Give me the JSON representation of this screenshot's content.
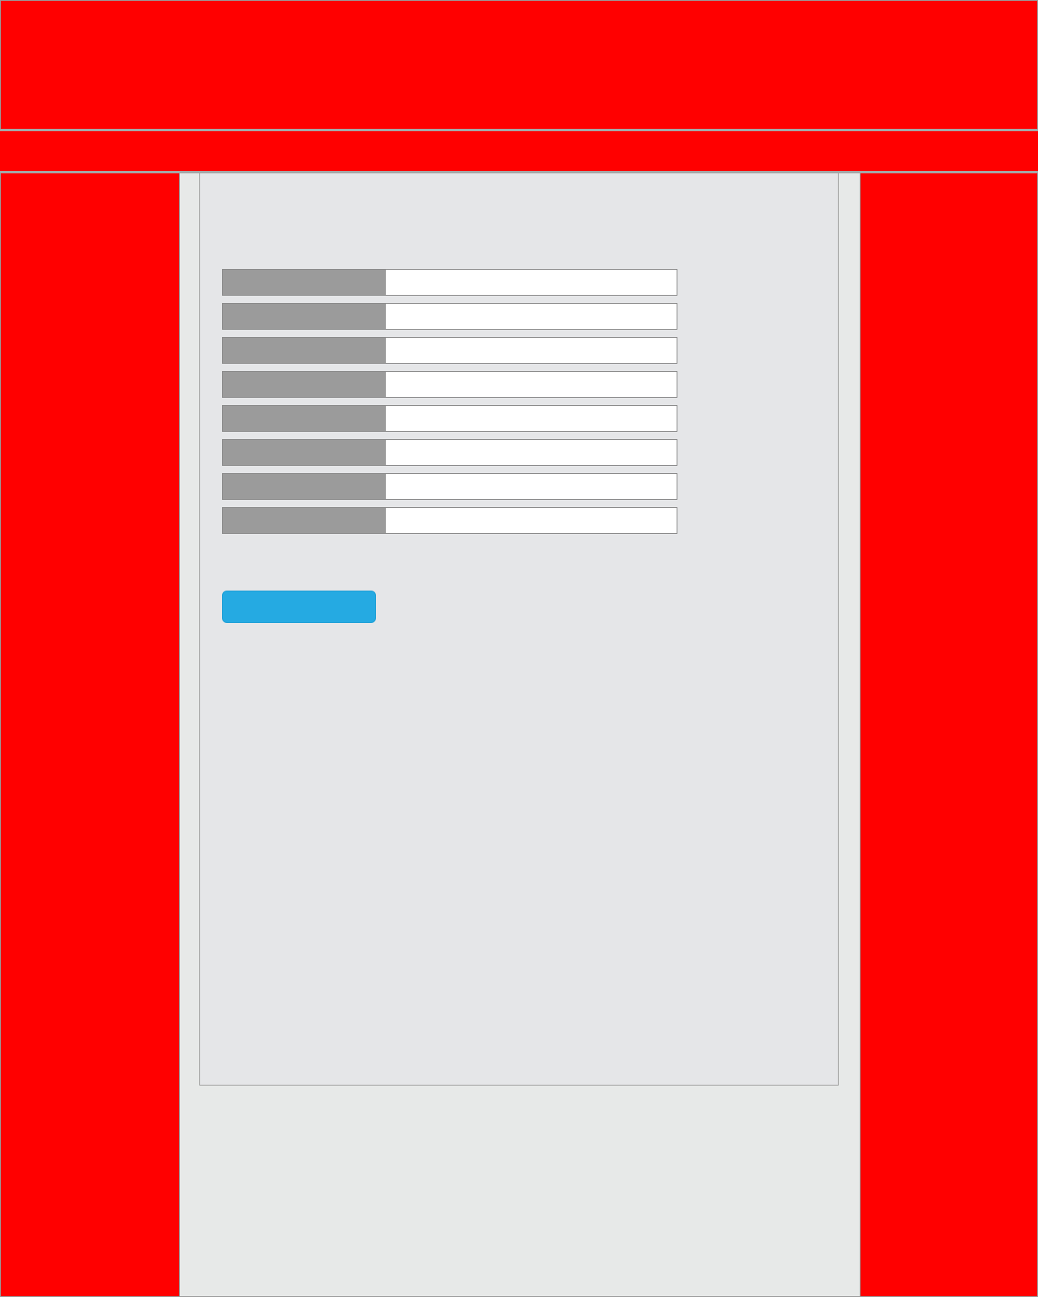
{
  "colors": {
    "header_background": "#ff0000",
    "gutter_background": "#ff0000",
    "divider": "#a6a6a6",
    "page_background": "#e7e9e8",
    "panel_background": "#e5e6e8",
    "row_label_background": "#9b9b9b",
    "row_value_background": "#ffffff",
    "button_background": "#25aae2"
  },
  "header": {
    "title": "",
    "nav_text": ""
  },
  "form": {
    "rows": [
      {
        "label": "",
        "value": ""
      },
      {
        "label": "",
        "value": ""
      },
      {
        "label": "",
        "value": ""
      },
      {
        "label": "",
        "value": ""
      },
      {
        "label": "",
        "value": ""
      },
      {
        "label": "",
        "value": ""
      },
      {
        "label": "",
        "value": ""
      },
      {
        "label": "",
        "value": ""
      }
    ],
    "submit_label": ""
  }
}
